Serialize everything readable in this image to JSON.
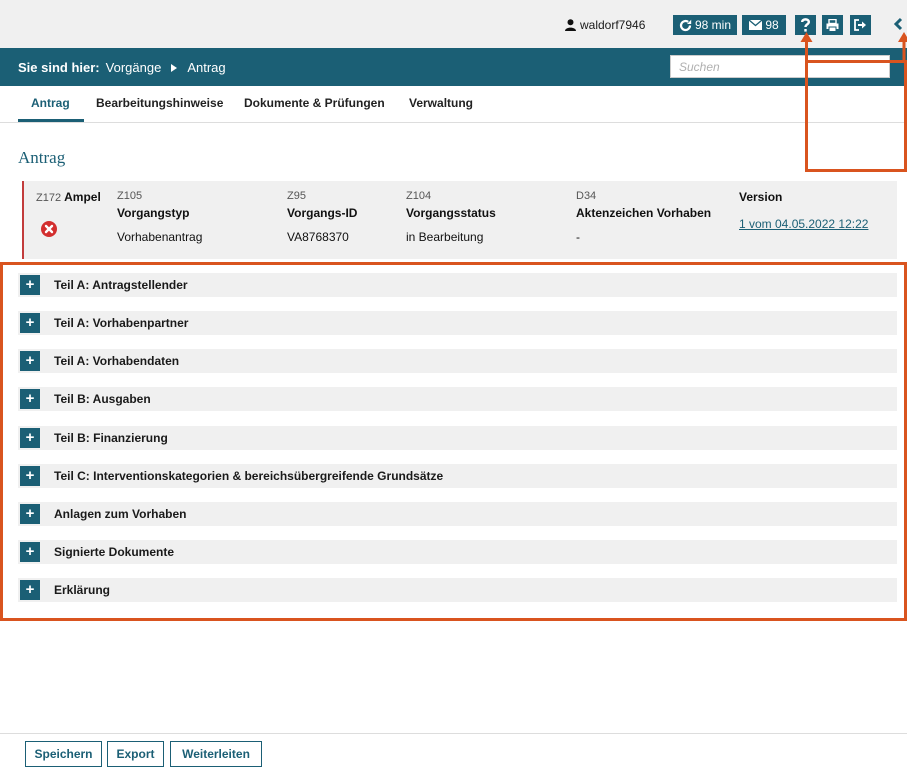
{
  "header": {
    "username": "waldorf7946",
    "session_label": "98 min",
    "messages_count": "98"
  },
  "nav": {
    "breadcrumb_prefix": "Sie sind hier:",
    "breadcrumb": [
      "Vorgänge",
      "Antrag"
    ],
    "search_placeholder": "Suchen"
  },
  "tabs": [
    {
      "label": "Antrag",
      "active": true
    },
    {
      "label": "Bearbeitungshinweise",
      "active": false
    },
    {
      "label": "Dokumente & Prüfungen",
      "active": false
    },
    {
      "label": "Verwaltung",
      "active": false
    }
  ],
  "page_title": "Antrag",
  "summary": {
    "ampel": {
      "code": "Z172",
      "label": "Ampel",
      "status_color": "#d32f2f"
    },
    "fields": [
      {
        "code": "Z105",
        "label": "Vorgangstyp",
        "value": "Vorhabenantrag"
      },
      {
        "code": "Z95",
        "label": "Vorgangs-ID",
        "value": "VA8768370"
      },
      {
        "code": "Z104",
        "label": "Vorgangsstatus",
        "value": "in Bearbeitung"
      },
      {
        "code": "D34",
        "label": "Aktenzeichen Vorhaben",
        "value": "-"
      }
    ],
    "version": {
      "label": "Version",
      "value": "1 vom 04.05.2022 12:22"
    }
  },
  "sections": [
    {
      "label": "Teil A: Antragstellender"
    },
    {
      "label": "Teil A: Vorhabenpartner"
    },
    {
      "label": "Teil A: Vorhabendaten"
    },
    {
      "label": "Teil B: Ausgaben"
    },
    {
      "label": "Teil B: Finanzierung"
    },
    {
      "label": "Teil C: Interventionskategorien & bereichsübergreifende Grundsätze"
    },
    {
      "label": "Anlagen zum Vorhaben"
    },
    {
      "label": "Signierte Dokumente"
    },
    {
      "label": "Erklärung"
    }
  ],
  "section_expand_symbol": "+",
  "footer": {
    "save_label": "Speichern",
    "export_label": "Export",
    "forward_label": "Weiterleiten"
  },
  "colors": {
    "primary": "#1b5f75",
    "highlight": "#d9541f",
    "panel": "#f0f0f0"
  }
}
